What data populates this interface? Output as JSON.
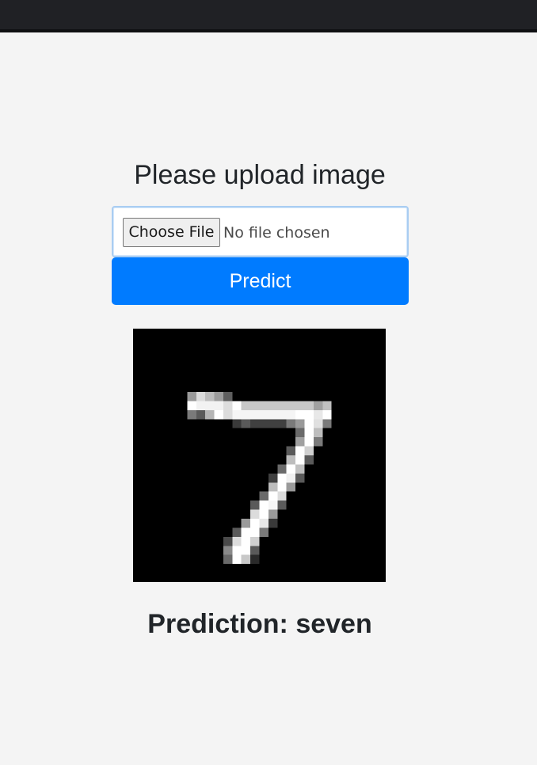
{
  "header": {
    "background": "#202125"
  },
  "upload": {
    "heading": "Please upload image",
    "choose_file_label": "Choose File",
    "file_status": "No file chosen"
  },
  "predict_button": {
    "label": "Predict",
    "color": "#007bff"
  },
  "result": {
    "image": "handwritten-digit-seven",
    "prediction_label": "Prediction:",
    "prediction_value": "seven"
  }
}
